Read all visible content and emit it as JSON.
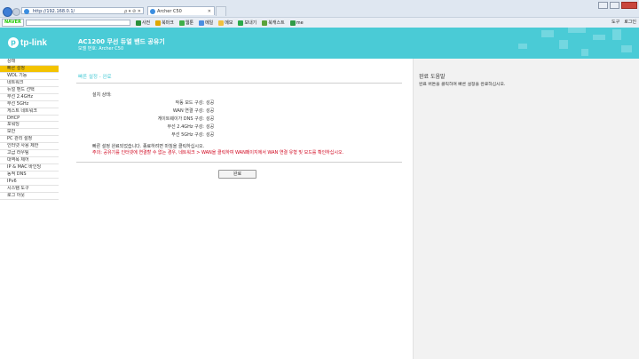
{
  "browser": {
    "url": "http://192.168.0.1/",
    "tab_title": "Archer C50",
    "naver_label": "NAVER",
    "toolbar_items": [
      "사전",
      "북마크",
      "웹툰",
      "메일",
      "메모",
      "보내기",
      "북캐스트",
      "me"
    ],
    "toolbar_right": [
      "도구",
      "로그인"
    ]
  },
  "header": {
    "logo_text": "tp-link",
    "model_title": "AC1200 무선 듀얼 밴드 공유기",
    "model_sub": "모델 번호: Archer C50"
  },
  "sidebar": {
    "items": [
      {
        "label": "상태"
      },
      {
        "label": "빠른 설정"
      },
      {
        "label": "WDL 기능"
      },
      {
        "label": "네트워크"
      },
      {
        "label": "듀얼 밴드 선택"
      },
      {
        "label": "무선 2.4GHz"
      },
      {
        "label": "무선 5GHz"
      },
      {
        "label": "게스트 네트워크"
      },
      {
        "label": "DHCP"
      },
      {
        "label": "포워딩"
      },
      {
        "label": "보안"
      },
      {
        "label": "PC 관리 설정"
      },
      {
        "label": "인터넷 사용 제한"
      },
      {
        "label": "고급 라우팅"
      },
      {
        "label": "대역폭 제어"
      },
      {
        "label": "IP & MAC 바인딩"
      },
      {
        "label": "동적 DNS"
      },
      {
        "label": "IPv6"
      },
      {
        "label": "시스템 도구"
      },
      {
        "label": "로그 아웃"
      }
    ],
    "active_index": 1
  },
  "main": {
    "section_title": "빠른 설정 - 완료",
    "done_heading": "설치 상태:",
    "status_rows": [
      {
        "label": "작동 모드 구성:",
        "value": "성공"
      },
      {
        "label": "WAN 연결 구성:",
        "value": "성공"
      },
      {
        "label": "게이트웨이가 DNS 구성:",
        "value": "성공"
      },
      {
        "label": "무선 2.4GHz 구성:",
        "value": "성공"
      },
      {
        "label": "무선 5GHz 구성:",
        "value": "성공"
      }
    ],
    "note_ok": "빠른 설정 완료되었습니다. 종료하려면 마침을 클릭하십시오.",
    "note_warn": "주의: 공유기를 인터넷에 연결할 수 없는 경우, 네트워크 > WAN을 클릭하여 WAN페이지에서 WAN 연결 유형 및 모드를 확인하십시오.",
    "finish_label": "완료"
  },
  "help": {
    "title": "완료 도움말",
    "text": "완료 버튼을 클릭하여 빠른 설정을 완료하십시오."
  },
  "colors": {
    "accent": "#4acbd6",
    "active_menu": "#f3c300",
    "warning": "#d0021b"
  }
}
